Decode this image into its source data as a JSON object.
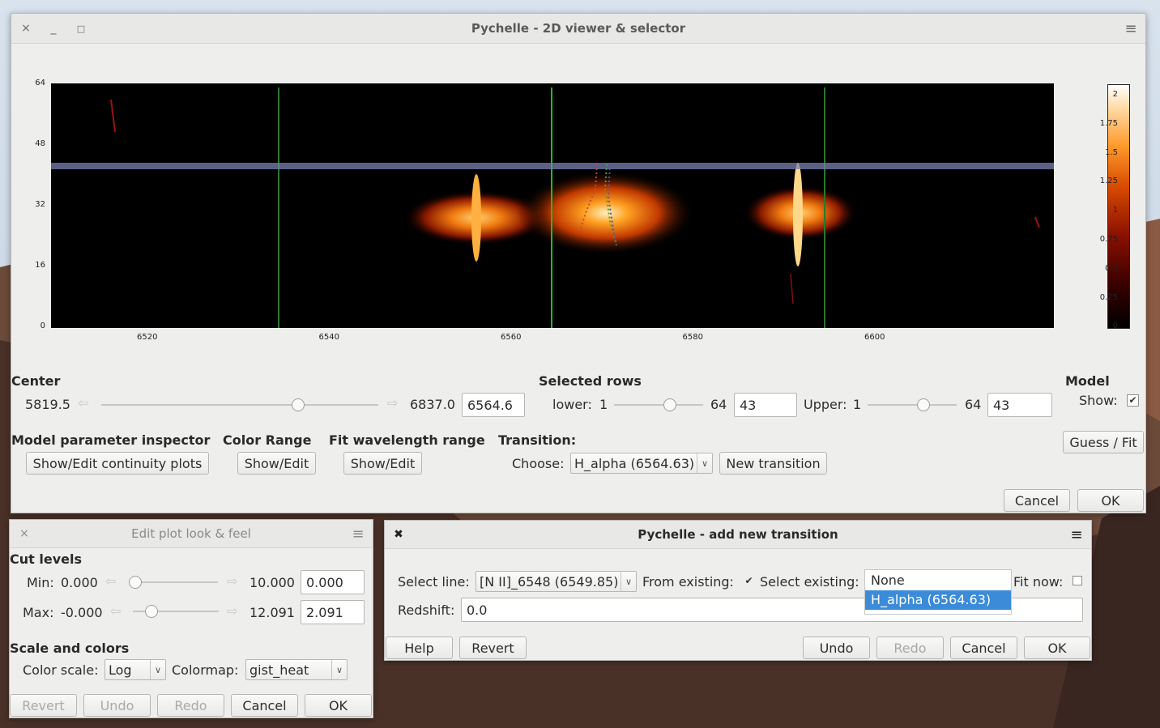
{
  "main_window": {
    "title": "Pychelle - 2D viewer & selector",
    "close_icon": "×",
    "min_icon": "_",
    "max_icon": "□",
    "menu_icon": "≡",
    "plot": {
      "y_ticks": [
        "64",
        "48",
        "32",
        "16",
        "0"
      ],
      "x_ticks": [
        "6520",
        "6540",
        "6560",
        "6580",
        "6600"
      ],
      "colorbar_ticks": [
        "2",
        "1.75",
        "1.5",
        "1.25",
        "1",
        "0.75",
        "0.5",
        "0.25",
        "0"
      ]
    },
    "center": {
      "title": "Center",
      "min": "5819.5",
      "max": "6837.0",
      "value": "6564.6",
      "slider_fraction": 0.72
    },
    "selected_rows": {
      "title": "Selected rows",
      "lower_label": "lower:",
      "lower_min": "1",
      "lower_max": "64",
      "lower_value": "43",
      "lower_fraction": 0.65,
      "upper_label": "Upper:",
      "upper_min": "1",
      "upper_max": "64",
      "upper_value": "43",
      "upper_fraction": 0.65
    },
    "model": {
      "title": "Model",
      "show_label": "Show:",
      "show_checked": true
    },
    "guess_fit_label": "Guess / Fit",
    "param_inspector": {
      "title": "Model parameter inspector",
      "button": "Show/Edit continuity plots"
    },
    "color_range": {
      "title": "Color Range",
      "button": "Show/Edit"
    },
    "fit_range": {
      "title": "Fit wavelength range",
      "button": "Show/Edit"
    },
    "transition": {
      "title": "Transition:",
      "choose_label": "Choose:",
      "selected": "H_alpha  (6564.63)",
      "new_button": "New transition"
    },
    "cancel_label": "Cancel",
    "ok_label": "OK"
  },
  "plot_window": {
    "title": "Edit plot look & feel",
    "cut_levels_title": "Cut levels",
    "min_label": "Min:",
    "min_low": "0.000",
    "min_high": "10.000",
    "min_value": "0.000",
    "min_fraction": 0.0,
    "max_label": "Max:",
    "max_low": "-0.000",
    "max_high": "12.091",
    "max_value": "2.091",
    "max_fraction": 0.17,
    "scale_title": "Scale and colors",
    "color_scale_label": "Color scale:",
    "color_scale_value": "Log",
    "colormap_label": "Colormap:",
    "colormap_value": "gist_heat",
    "revert_label": "Revert",
    "undo_label": "Undo",
    "redo_label": "Redo",
    "cancel_label": "Cancel",
    "ok_label": "OK"
  },
  "transition_window": {
    "title": "Pychelle - add new transition",
    "select_line_label": "Select line:",
    "select_line_value": "[N II]_6548  (6549.85)",
    "from_existing_label": "From existing:",
    "from_existing_checked": true,
    "select_existing_label": "Select existing:",
    "options": [
      "None",
      "H_alpha  (6564.63)"
    ],
    "fit_now_label": "Fit now:",
    "redshift_label": "Redshift:",
    "redshift_value": "0.0",
    "help_label": "Help",
    "revert_label": "Revert",
    "undo_label": "Undo",
    "redo_label": "Redo",
    "cancel_label": "Cancel",
    "ok_label": "OK"
  }
}
